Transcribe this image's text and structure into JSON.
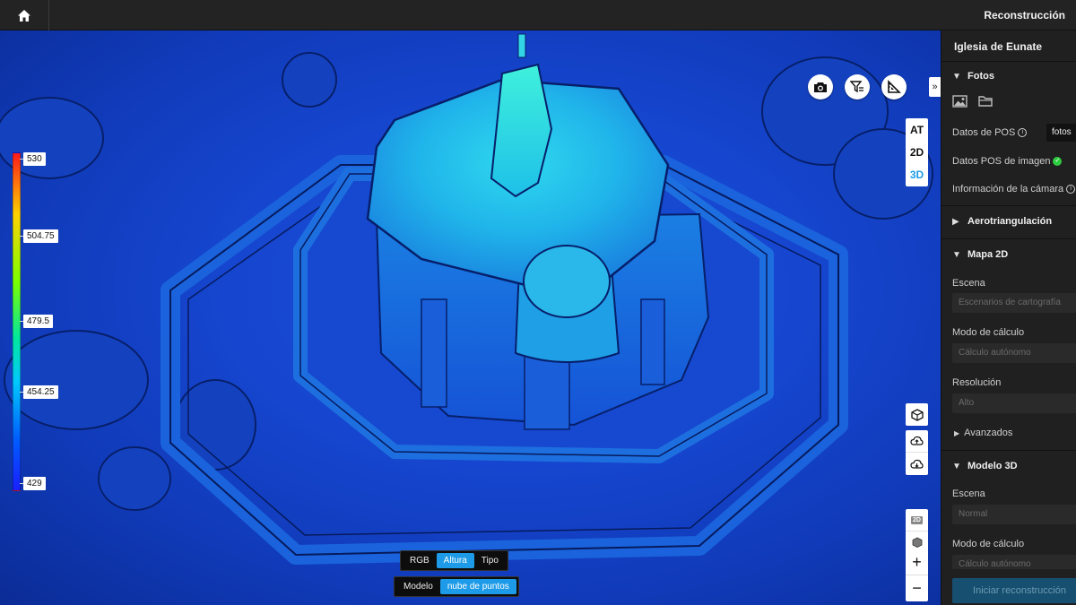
{
  "header": {
    "app_title": "Reconstrucción"
  },
  "viewport": {
    "colorbar": {
      "labels": [
        "530",
        "504.75",
        "479.5",
        "454.25",
        "429"
      ],
      "max": 530,
      "min": 429
    },
    "view_modes": [
      {
        "label": "AT",
        "active": false
      },
      {
        "label": "2D",
        "active": false
      },
      {
        "label": "3D",
        "active": true
      }
    ],
    "color_toggle": {
      "options": [
        "RGB",
        "Altura",
        "Tipo"
      ],
      "active": "Altura"
    },
    "display_toggle": {
      "options": [
        "Modelo",
        "nube de puntos"
      ],
      "active": "nube de puntos"
    },
    "mini_2d_label": "2D",
    "zoom_in": "+",
    "zoom_out": "−"
  },
  "panel": {
    "project_title": "Iglesia de Eunate",
    "fotos": {
      "heading": "Fotos",
      "pos_label": "Datos de POS",
      "pos_button": "fotos",
      "image_pos_label": "Datos POS de imagen",
      "camera_info_label": "Información de la cámara"
    },
    "aerotriangulation": {
      "heading": "Aerotriangulación"
    },
    "map2d": {
      "heading": "Mapa 2D",
      "scene_label": "Escena",
      "scene_value": "Escenarios de cartografía",
      "calc_label": "Modo de cálculo",
      "calc_value": "Cálculo autónomo",
      "resolution_label": "Resolución",
      "resolution_value": "Alto",
      "advanced_label": "Avanzados"
    },
    "model3d": {
      "heading": "Modelo 3D",
      "scene_label": "Escena",
      "scene_value": "Normal",
      "calc_label": "Modo de cálculo",
      "calc_value": "Cálculo autónomo"
    },
    "start_button": "Iniciar reconstrucción"
  }
}
